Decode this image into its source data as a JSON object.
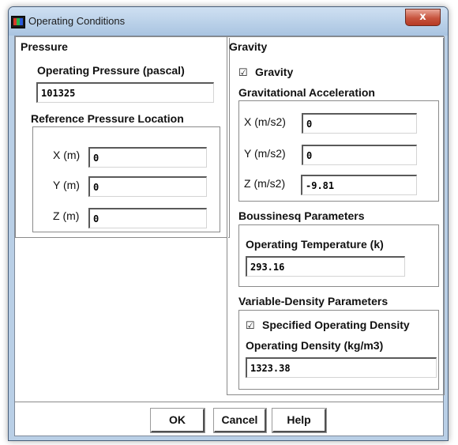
{
  "window": {
    "title": "Operating Conditions",
    "close_glyph": "x"
  },
  "pressure": {
    "title": "Pressure",
    "operating_pressure_label": "Operating Pressure (pascal)",
    "operating_pressure_value": "101325",
    "ref_location": {
      "title": "Reference Pressure Location",
      "x_label": "X (m)",
      "x_value": "0",
      "y_label": "Y (m)",
      "y_value": "0",
      "z_label": "Z (m)",
      "z_value": "0"
    }
  },
  "gravity": {
    "title": "Gravity",
    "checkbox_label": "Gravity",
    "checkbox_checked": true,
    "check_glyph": "☑",
    "acceleration": {
      "title": "Gravitational Acceleration",
      "x_label": "X (m/s2)",
      "x_value": "0",
      "y_label": "Y (m/s2)",
      "y_value": "0",
      "z_label": "Z (m/s2)",
      "z_value": "-9.81"
    },
    "boussinesq": {
      "title": "Boussinesq Parameters",
      "temp_label": "Operating Temperature (k)",
      "temp_value": "293.16"
    },
    "variable_density": {
      "title": "Variable-Density Parameters",
      "checkbox_label": "Specified Operating Density",
      "checkbox_checked": true,
      "density_label": "Operating Density (kg/m3)",
      "density_value": "1323.38"
    }
  },
  "buttons": {
    "ok": "OK",
    "cancel": "Cancel",
    "help": "Help"
  }
}
